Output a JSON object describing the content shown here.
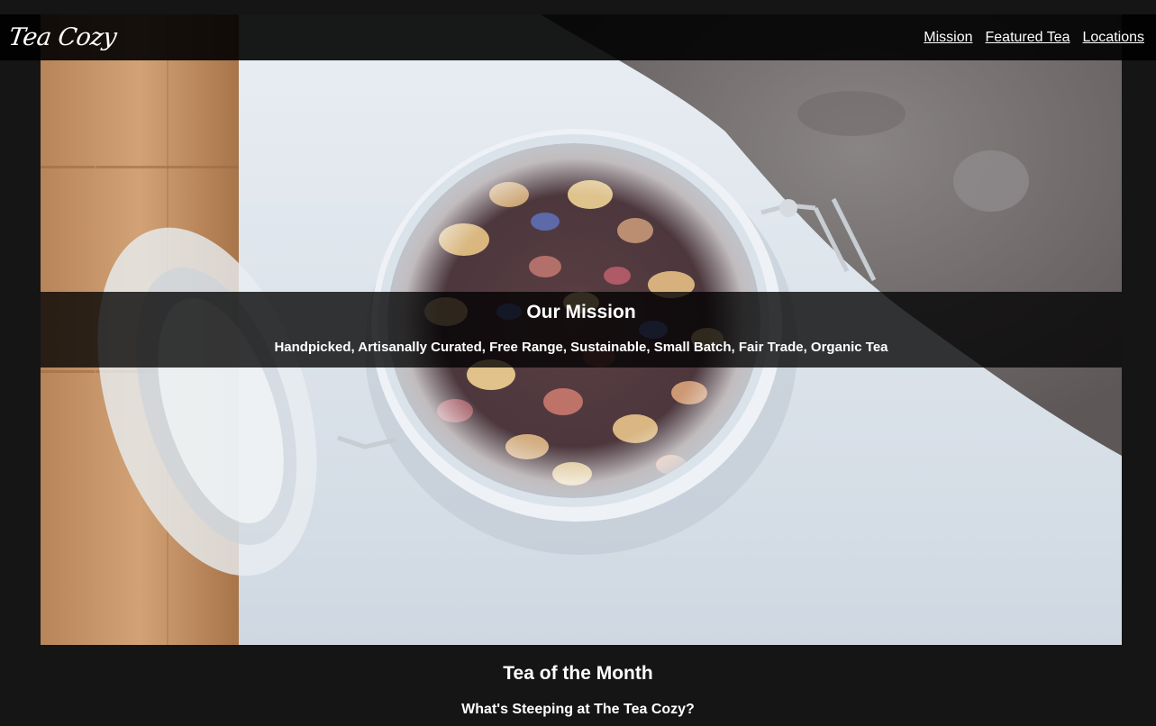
{
  "header": {
    "logo": "Tea Cozy",
    "nav": [
      {
        "label": "Mission"
      },
      {
        "label": "Featured Tea"
      },
      {
        "label": "Locations"
      }
    ]
  },
  "hero": {
    "image": "tea-jar-photo"
  },
  "mission": {
    "title": "Our Mission",
    "text": "Handpicked, Artisanally Curated, Free Range, Sustainable, Small Batch, Fair Trade, Organic Tea"
  },
  "tea_of_month": {
    "title": "Tea of the Month",
    "subtitle": "What's Steeping at The Tea Cozy?"
  },
  "colors": {
    "page_background": "#151515",
    "header_background": "#000000",
    "text": "#ffffff"
  }
}
